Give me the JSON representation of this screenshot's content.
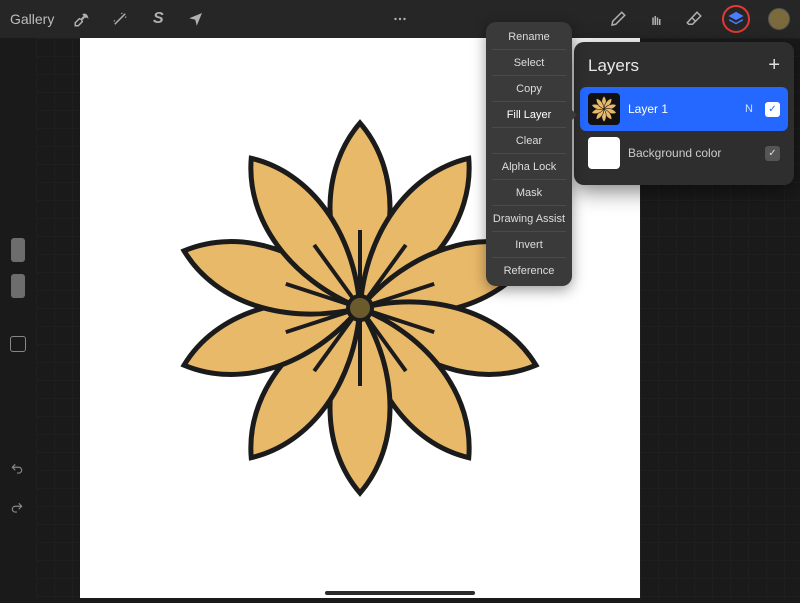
{
  "toolbar": {
    "gallery": "Gallery"
  },
  "context_menu": {
    "items": [
      "Rename",
      "Select",
      "Copy",
      "Fill Layer",
      "Clear",
      "Alpha Lock",
      "Mask",
      "Drawing Assist",
      "Invert",
      "Reference"
    ],
    "selected_index": 3
  },
  "layers_panel": {
    "title": "Layers",
    "rows": [
      {
        "name": "Layer 1",
        "blend_mode": "N",
        "visible": true,
        "selected": true
      },
      {
        "name": "Background color",
        "visible": true,
        "selected": false
      }
    ]
  },
  "colors": {
    "accent": "#2468ff",
    "highlight_ring": "#e53935",
    "swatch": "#7a6a3c",
    "petal_fill": "#e9b96a",
    "petal_stroke": "#1b1b1b",
    "flower_center": "#6b5a2b"
  },
  "icons": {
    "wrench": "wrench-icon",
    "wand": "wand-icon",
    "s_tool": "selection-icon",
    "arrow_tool": "move-icon",
    "ellipsis": "menu-icon",
    "brush": "brush-icon",
    "smudge": "smudge-icon",
    "eraser": "eraser-icon",
    "layers": "layers-icon"
  }
}
